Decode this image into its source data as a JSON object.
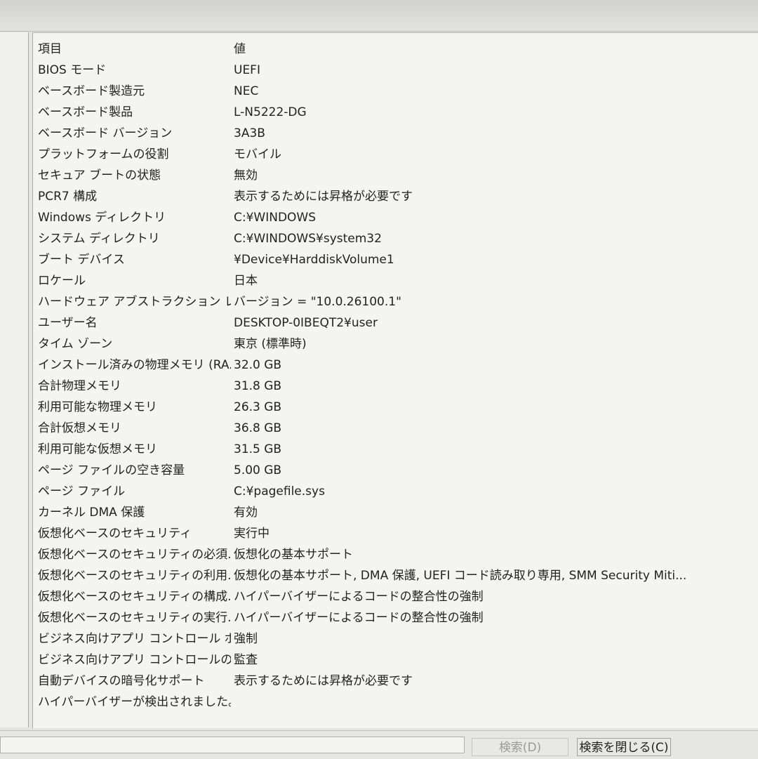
{
  "table": {
    "header": {
      "item": "項目",
      "value": "値"
    },
    "rows": [
      {
        "item": "BIOS モード",
        "value": "UEFI"
      },
      {
        "item": "ベースボード製造元",
        "value": "NEC"
      },
      {
        "item": "ベースボード製品",
        "value": "L-N5222-DG"
      },
      {
        "item": "ベースボード バージョン",
        "value": "3A3B"
      },
      {
        "item": "プラットフォームの役割",
        "value": "モバイル"
      },
      {
        "item": "セキュア ブートの状態",
        "value": "無効"
      },
      {
        "item": "PCR7 構成",
        "value": "表示するためには昇格が必要です"
      },
      {
        "item": "Windows ディレクトリ",
        "value": "C:¥WINDOWS"
      },
      {
        "item": "システム ディレクトリ",
        "value": "C:¥WINDOWS¥system32"
      },
      {
        "item": "ブート デバイス",
        "value": "¥Device¥HarddiskVolume1"
      },
      {
        "item": "ロケール",
        "value": "日本"
      },
      {
        "item": "ハードウェア アブストラクション レイ...",
        "value": "バージョン = \"10.0.26100.1\""
      },
      {
        "item": "ユーザー名",
        "value": "DESKTOP-0IBEQT2¥user"
      },
      {
        "item": "タイム ゾーン",
        "value": "東京 (標準時)"
      },
      {
        "item": "インストール済みの物理メモリ (RA...",
        "value": "32.0 GB"
      },
      {
        "item": "合計物理メモリ",
        "value": "31.8 GB"
      },
      {
        "item": "利用可能な物理メモリ",
        "value": "26.3 GB"
      },
      {
        "item": "合計仮想メモリ",
        "value": "36.8 GB"
      },
      {
        "item": "利用可能な仮想メモリ",
        "value": "31.5 GB"
      },
      {
        "item": "ページ ファイルの空き容量",
        "value": "5.00 GB"
      },
      {
        "item": "ページ ファイル",
        "value": "C:¥pagefile.sys"
      },
      {
        "item": "カーネル DMA 保護",
        "value": "有効"
      },
      {
        "item": "仮想化ベースのセキュリティ",
        "value": "実行中"
      },
      {
        "item": "仮想化ベースのセキュリティの必須...",
        "value": "仮想化の基本サポート"
      },
      {
        "item": "仮想化ベースのセキュリティの利用...",
        "value": "仮想化の基本サポート, DMA 保護, UEFI コード読み取り専用, SMM Security Miti..."
      },
      {
        "item": "仮想化ベースのセキュリティの構成...",
        "value": "ハイパーバイザーによるコードの整合性の強制"
      },
      {
        "item": "仮想化ベースのセキュリティの実行...",
        "value": "ハイパーバイザーによるコードの整合性の強制"
      },
      {
        "item": "ビジネス向けアプリ コントロール ポリ...",
        "value": "強制"
      },
      {
        "item": "ビジネス向けアプリ コントロールのユ...",
        "value": "監査"
      },
      {
        "item": "自動デバイスの暗号化サポート",
        "value": "表示するためには昇格が必要です"
      },
      {
        "item": "ハイパーバイザーが検出されました。...",
        "value": ""
      }
    ]
  },
  "bottom": {
    "search_label": "検索(D)",
    "close_search_label": "検索を閉じる(C)"
  }
}
